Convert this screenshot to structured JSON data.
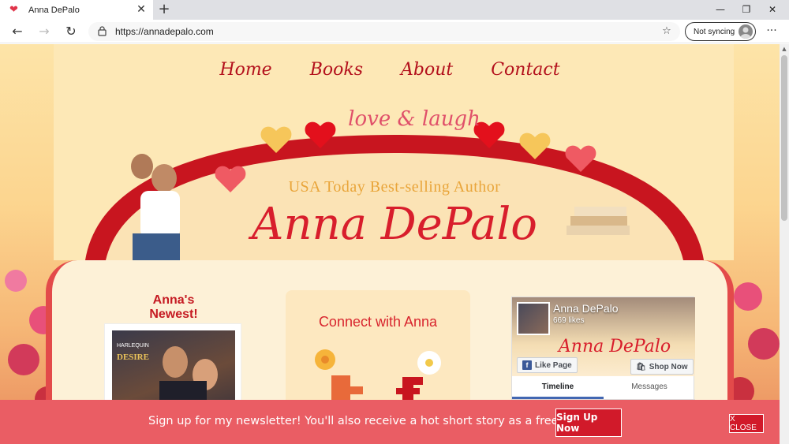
{
  "browser": {
    "tab_title": "Anna DePalo",
    "url": "https://annadepalo.com",
    "sync_label": "Not syncing"
  },
  "nav": {
    "items": [
      {
        "label": "Home"
      },
      {
        "label": "Books"
      },
      {
        "label": "About"
      },
      {
        "label": "Contact"
      }
    ]
  },
  "header": {
    "tagline": "love & laugh",
    "subtitle": "USA Today Best-selling Author",
    "author_name": "Anna DePalo"
  },
  "newest": {
    "title": "Anna's Newest!",
    "publisher": "HARLEQUIN",
    "line": "DESIRE"
  },
  "connect": {
    "title": "Connect with Anna"
  },
  "facebook": {
    "page_name": "Anna DePalo",
    "likes": "669 likes",
    "cover_name": "Anna DePalo",
    "like_button": "Like Page",
    "shop_button": "Shop Now",
    "tabs": [
      "Timeline",
      "Messages"
    ]
  },
  "newsletter": {
    "message": "Sign up for my newsletter! You'll also receive a hot short story as a free gift!",
    "signup_label": "Sign Up Now",
    "close_label": "X CLOSE"
  },
  "colors": {
    "accent_red": "#d81e2c",
    "newsletter_bg": "#ea5d64",
    "gold": "#e9a53a"
  }
}
